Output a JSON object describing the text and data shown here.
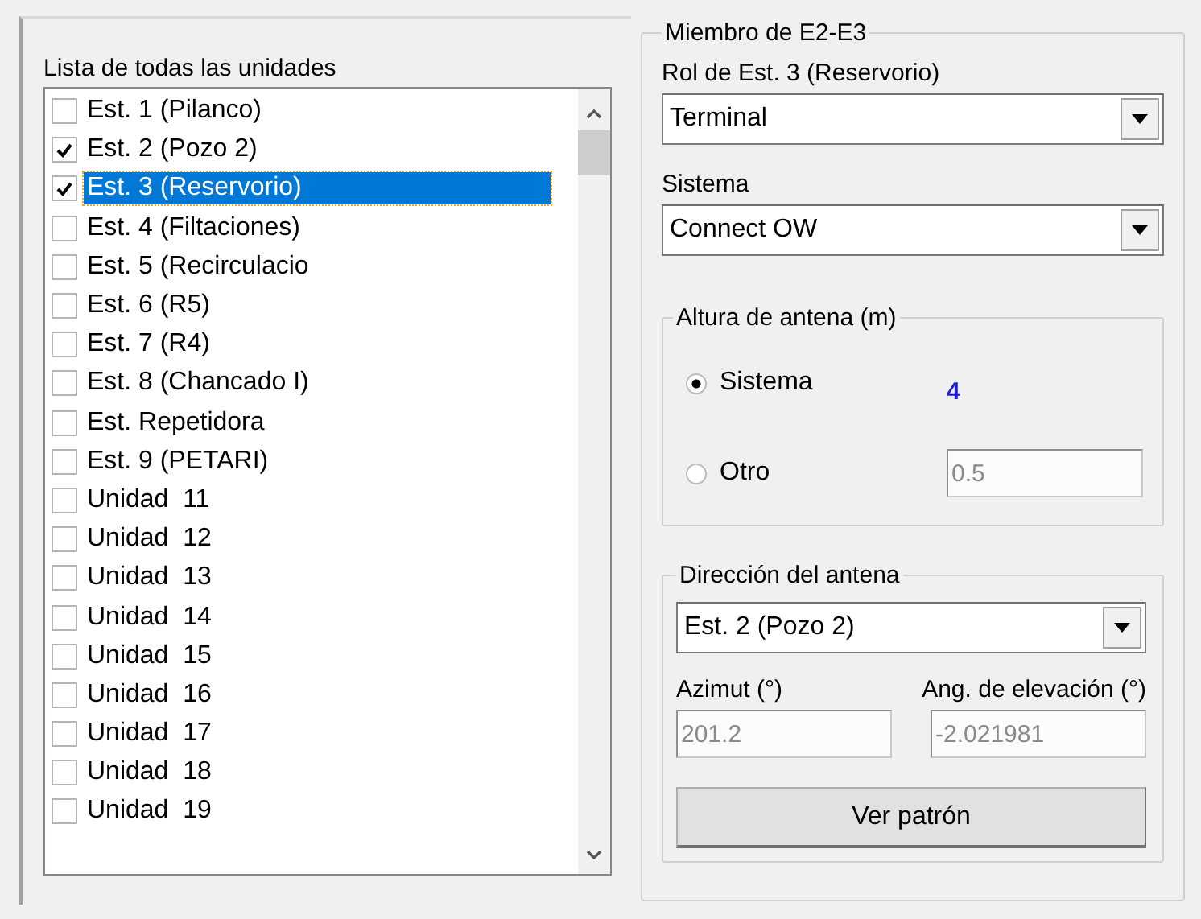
{
  "units_panel": {
    "title": "Lista de todas las unidades",
    "items": [
      {
        "label": "Est. 1 (Pilanco)",
        "checked": false,
        "selected": false
      },
      {
        "label": "Est. 2 (Pozo 2)",
        "checked": true,
        "selected": false
      },
      {
        "label": "Est. 3 (Reservorio)",
        "checked": true,
        "selected": true
      },
      {
        "label": "Est. 4 (Filtaciones)",
        "checked": false,
        "selected": false
      },
      {
        "label": "Est. 5 (Recirculacio",
        "checked": false,
        "selected": false
      },
      {
        "label": "Est. 6 (R5)",
        "checked": false,
        "selected": false
      },
      {
        "label": "Est. 7 (R4)",
        "checked": false,
        "selected": false
      },
      {
        "label": "Est. 8 (Chancado I)",
        "checked": false,
        "selected": false
      },
      {
        "label": "Est. Repetidora",
        "checked": false,
        "selected": false
      },
      {
        "label": "Est. 9 (PETARI)",
        "checked": false,
        "selected": false
      },
      {
        "label": "Unidad  11",
        "checked": false,
        "selected": false
      },
      {
        "label": "Unidad  12",
        "checked": false,
        "selected": false
      },
      {
        "label": "Unidad  13",
        "checked": false,
        "selected": false
      },
      {
        "label": "Unidad  14",
        "checked": false,
        "selected": false
      },
      {
        "label": "Unidad  15",
        "checked": false,
        "selected": false
      },
      {
        "label": "Unidad  16",
        "checked": false,
        "selected": false
      },
      {
        "label": "Unidad  17",
        "checked": false,
        "selected": false
      },
      {
        "label": "Unidad  18",
        "checked": false,
        "selected": false
      },
      {
        "label": "Unidad  19",
        "checked": false,
        "selected": false
      }
    ]
  },
  "member_group": {
    "title": "Miembro de E2-E3",
    "role_label": "Rol de Est. 3 (Reservorio)",
    "role_value": "Terminal",
    "system_label": "Sistema",
    "system_value": "Connect OW",
    "antenna_height": {
      "title": "Altura de antena (m)",
      "options": [
        {
          "label": "Sistema",
          "selected": true,
          "value": "4",
          "kind": "reading"
        },
        {
          "label": "Otro",
          "selected": false,
          "value": "0.5",
          "kind": "field"
        }
      ]
    },
    "antenna_direction": {
      "title": "Dirección del antena",
      "target_value": "Est. 2 (Pozo 2)",
      "azimuth_label": "Azimut (°)",
      "azimuth_value": "201.2",
      "elevation_label": "Ang. de elevación (°)",
      "elevation_value": "-2.021981",
      "button": "Ver patrón"
    }
  }
}
